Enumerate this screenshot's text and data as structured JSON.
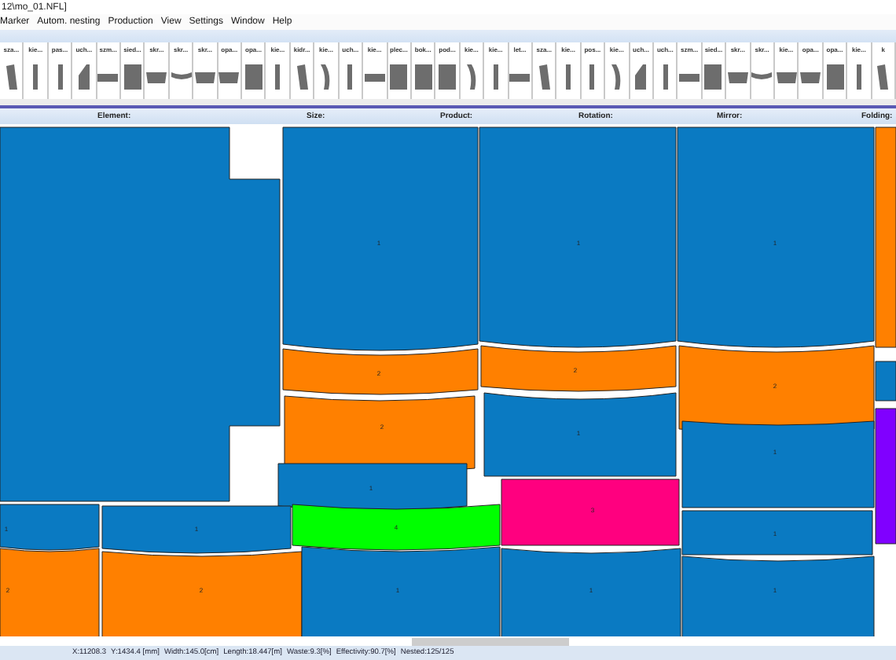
{
  "window": {
    "title": "12\\mo_01.NFL]"
  },
  "menu": [
    "Marker",
    "Autom. nesting",
    "Production",
    "View",
    "Settings",
    "Window",
    "Help"
  ],
  "parts_toolbar": [
    "sza...",
    "kie...",
    "pas...",
    "uch...",
    "szm...",
    "sied...",
    "skr...",
    "skr...",
    "skr...",
    "opa...",
    "opa...",
    "kie...",
    "kidr...",
    "kie...",
    "uch...",
    "kie...",
    "plec...",
    "bok...",
    "pod...",
    "kie...",
    "kie...",
    "let...",
    "sza...",
    "kie...",
    "pos...",
    "kie...",
    "uch...",
    "uch...",
    "szm...",
    "sied...",
    "skr...",
    "skr...",
    "kie...",
    "opa...",
    "opa...",
    "kie...",
    "k"
  ],
  "header": [
    "Element:",
    "Size:",
    "Product:",
    "Rotation:",
    "Mirror:",
    "Folding:"
  ],
  "pieces": [
    {
      "color": "#0a7ac2"
    },
    {
      "label": "1",
      "color": "#0a7ac2"
    },
    {
      "label": "1",
      "color": "#0a7ac2"
    },
    {
      "label": "1",
      "color": "#0a7ac2"
    },
    {
      "color": "#ff8000"
    },
    {
      "label": "2",
      "color": "#ff8000"
    },
    {
      "label": "2",
      "color": "#ff8000"
    },
    {
      "label": "2",
      "color": "#ff8000"
    },
    {
      "label": "2",
      "color": "#ff8000"
    },
    {
      "label": "1",
      "color": "#0a7ac2"
    },
    {
      "color": "#0a7ac2"
    },
    {
      "label": "1",
      "color": "#0a7ac2"
    },
    {
      "label": "1",
      "color": "#0a7ac2"
    },
    {
      "color": "#8000ff"
    },
    {
      "label": "4",
      "color": "#00ff00"
    },
    {
      "label": "3",
      "color": "#ff007f"
    },
    {
      "label": "1",
      "color": "#0a7ac2"
    },
    {
      "label": "1",
      "color": "#0a7ac2"
    },
    {
      "label": "1",
      "color": "#0a7ac2"
    },
    {
      "label": "2",
      "color": "#ff8000"
    },
    {
      "label": "2",
      "color": "#ff8000"
    },
    {
      "label": "1",
      "color": "#0a7ac2"
    },
    {
      "label": "1",
      "color": "#0a7ac2"
    },
    {
      "label": "1",
      "color": "#0a7ac2"
    }
  ],
  "status_bar": [
    "X:11208.3",
    "Y:1434.4 [mm]",
    "Width:145.0[cm]",
    "Length:18.447[m]",
    "Waste:9.3[%]",
    "Effectivity:90.7[%]",
    "Nested:125/125"
  ]
}
